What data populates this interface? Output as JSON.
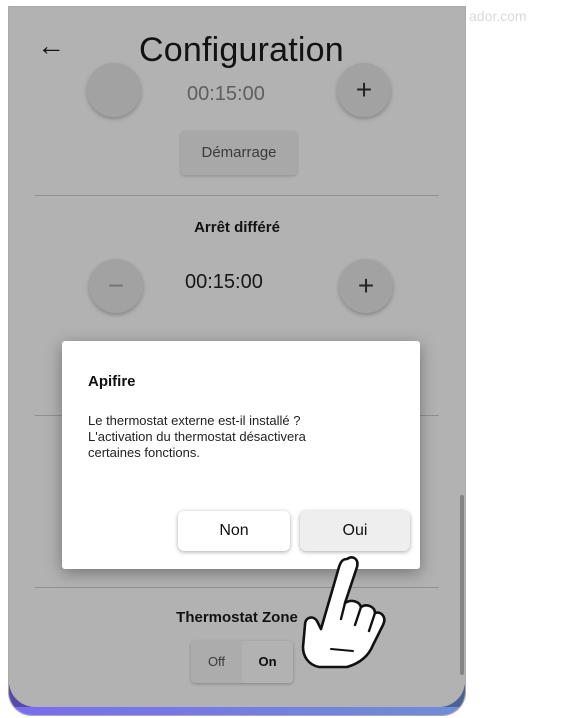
{
  "watermark": "ador.com",
  "header": {
    "title": "Configuration",
    "back_icon": "arrow-left-icon"
  },
  "delayed_start": {
    "timer": "00:15:00",
    "button_label": "Démarrage"
  },
  "delayed_stop": {
    "label": "Arrêt différé",
    "timer": "00:15:00",
    "minus": "−",
    "plus": "+"
  },
  "thermostat_zone": {
    "label": "Thermostat Zone",
    "options": [
      "Off",
      "On"
    ],
    "selected": "On"
  },
  "dialog": {
    "title": "Apifire",
    "message_lines": [
      "Le thermostat externe est-il installé ?",
      "L'activation du thermostat désactivera",
      "certaines fonctions."
    ],
    "buttons": {
      "no": "Non",
      "yes": "Oui"
    }
  },
  "colors": {
    "overlay": "#000000",
    "bottom_bar": "#7a6cf0"
  }
}
